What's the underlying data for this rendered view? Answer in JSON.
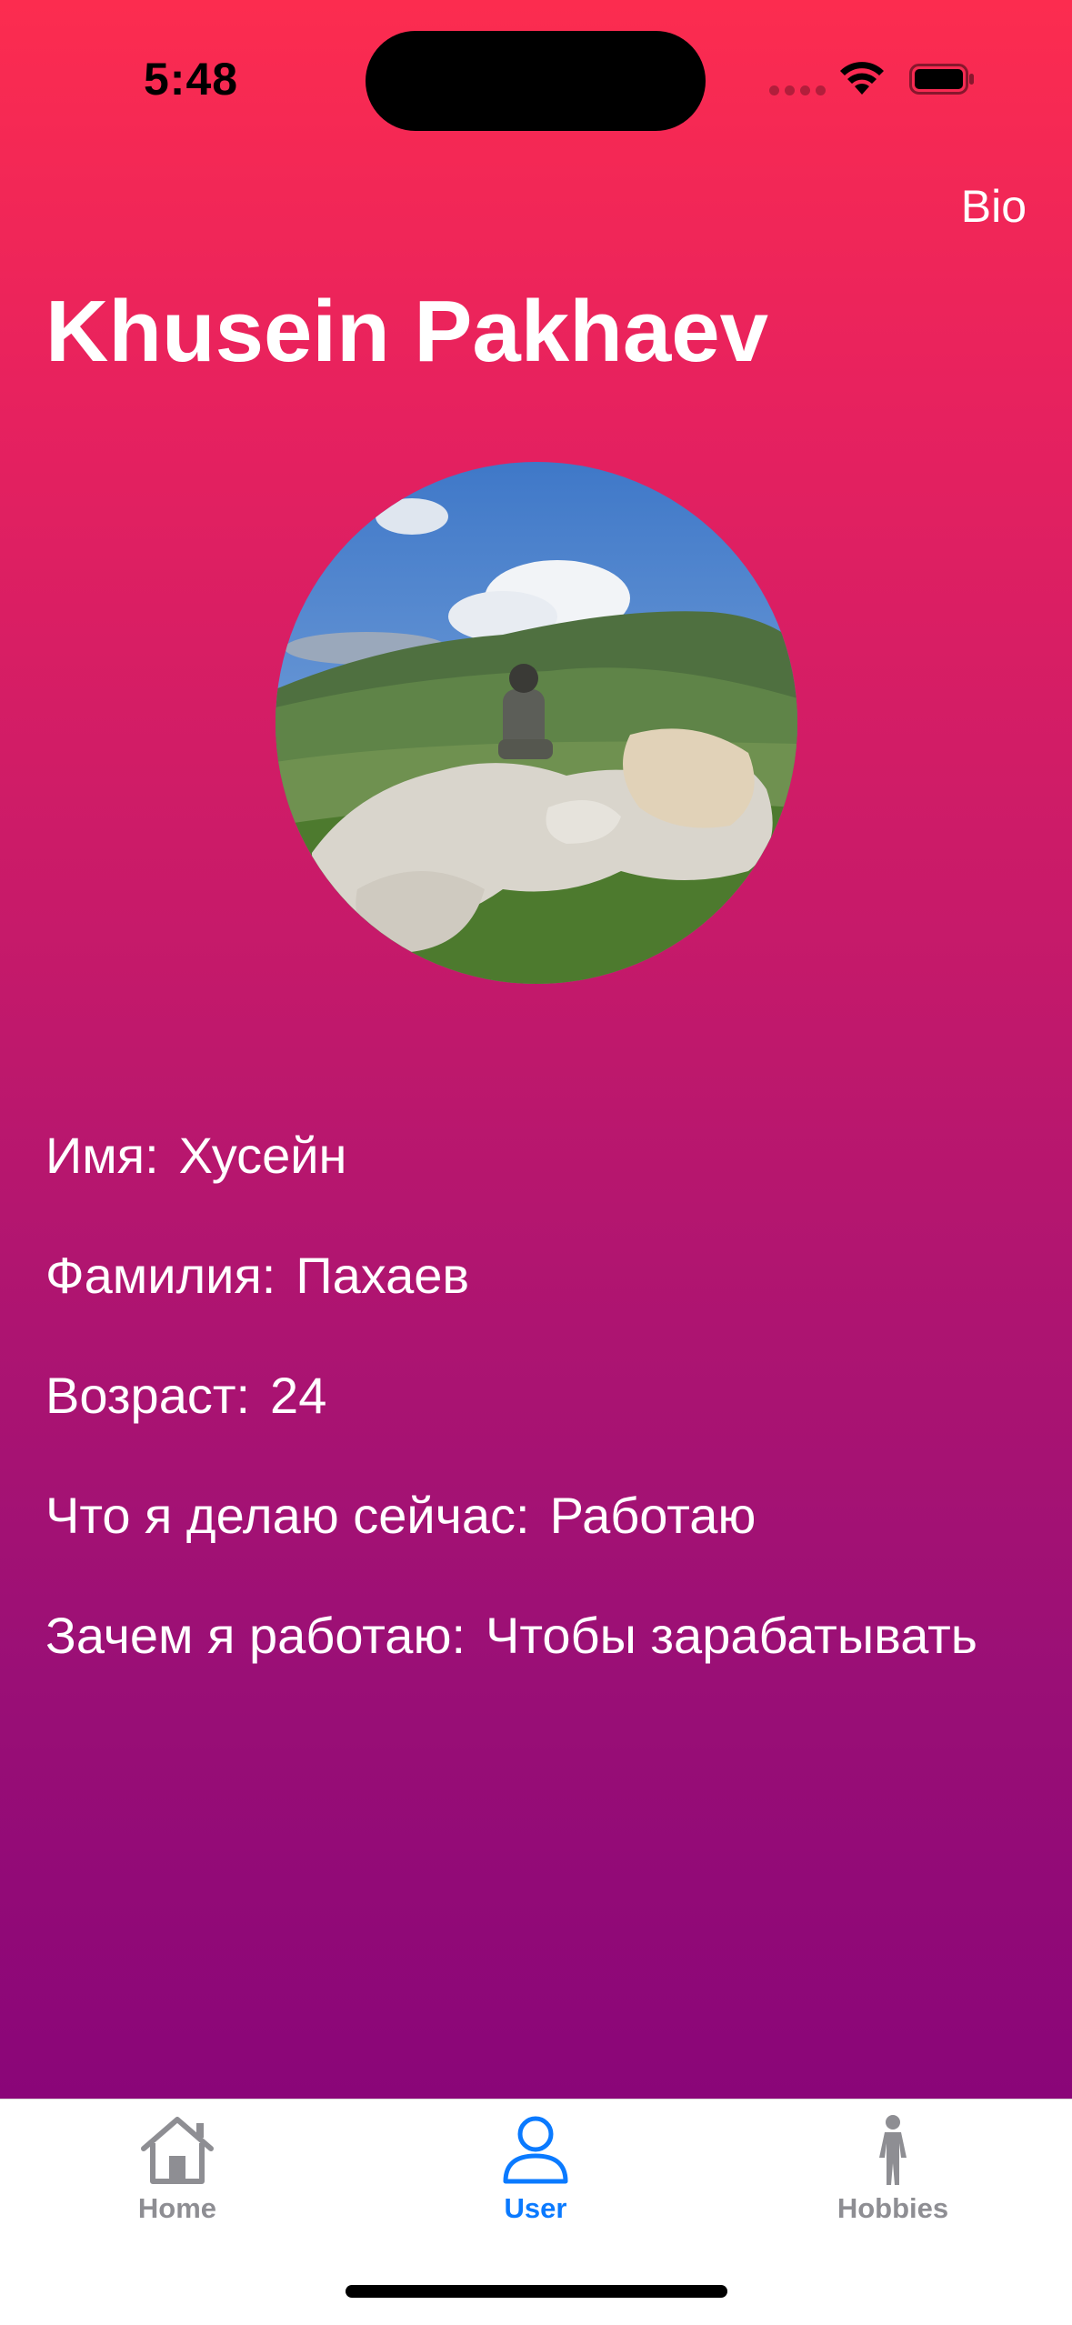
{
  "status_bar": {
    "time": "5:48"
  },
  "nav": {
    "right_button": "Bio",
    "title": "Khusein Pakhaev"
  },
  "avatar": {
    "description_icon": "profile-photo"
  },
  "info": [
    {
      "label": "Имя:",
      "value": "Хусейн"
    },
    {
      "label": "Фамилия:",
      "value": "Пахаев"
    },
    {
      "label": "Возраст:",
      "value": "24"
    },
    {
      "label": "Что я делаю сейчас:",
      "value": "Работаю"
    },
    {
      "label": "Зачем я работаю:",
      "value": "Чтобы зарабатывать"
    }
  ],
  "tabs": [
    {
      "label": "Home",
      "icon": "house-icon",
      "active": false
    },
    {
      "label": "User",
      "icon": "person-icon",
      "active": true
    },
    {
      "label": "Hobbies",
      "icon": "figure-walk-icon",
      "active": false
    }
  ],
  "colors": {
    "gradient_top": "#fc2c4f",
    "gradient_bottom": "#8a0578",
    "tab_active": "#0a7aff",
    "tab_inactive": "#8e8e93"
  }
}
